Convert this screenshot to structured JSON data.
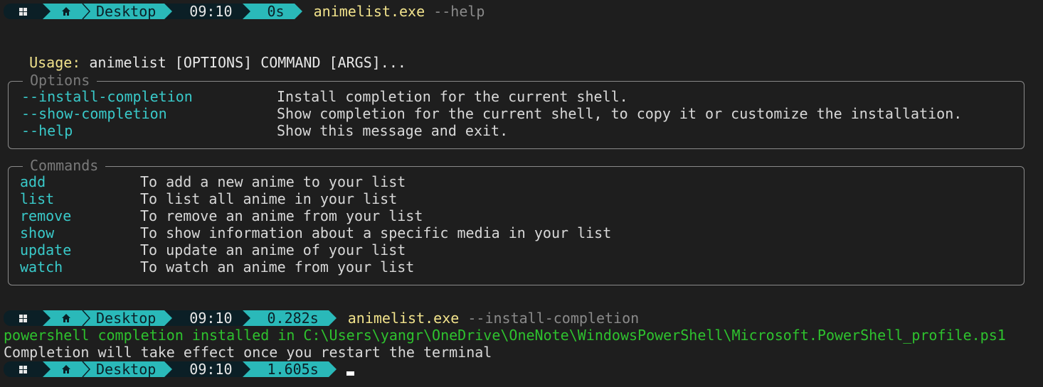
{
  "prompts": [
    {
      "dir": "Desktop",
      "time": "09:10",
      "duration": "0s",
      "command": "animelist.exe",
      "args": "--help"
    },
    {
      "dir": "Desktop",
      "time": "09:10",
      "duration": "0.282s",
      "command": "animelist.exe",
      "args": "--install-completion"
    },
    {
      "dir": "Desktop",
      "time": "09:10",
      "duration": "1.605s",
      "command": "",
      "args": ""
    }
  ],
  "usage": {
    "label": "Usage:",
    "text": "animelist [OPTIONS] COMMAND [ARGS]..."
  },
  "options": {
    "title": "Options",
    "items": [
      {
        "name": "--install-completion",
        "desc": "Install completion for the current shell."
      },
      {
        "name": "--show-completion",
        "desc": "Show completion for the current shell, to copy it or customize the installation."
      },
      {
        "name": "--help",
        "desc": "Show this message and exit."
      }
    ]
  },
  "commands": {
    "title": "Commands",
    "items": [
      {
        "name": "add",
        "desc": "To add a new anime to your list"
      },
      {
        "name": "list",
        "desc": "To list all anime in your list"
      },
      {
        "name": "remove",
        "desc": "To remove an anime from your list"
      },
      {
        "name": "show",
        "desc": "To show information about a specific media in your list"
      },
      {
        "name": "update",
        "desc": "To update an anime of your list"
      },
      {
        "name": "watch",
        "desc": "To watch an anime from your list"
      }
    ]
  },
  "output": {
    "installed": "powershell completion installed in C:\\Users\\yangr\\OneDrive\\OneNote\\WindowsPowerShell\\Microsoft.PowerShell_profile.ps1",
    "restart": "Completion will take effect once you restart the terminal"
  },
  "colors": {
    "prompt_teal": "#2ab9b9",
    "prompt_dark": "#0b1f26",
    "command": "#f2e38c",
    "option": "#39c9c9",
    "success": "#2ec22e"
  },
  "icons": {
    "os": "windows-icon",
    "home": "home-icon"
  }
}
